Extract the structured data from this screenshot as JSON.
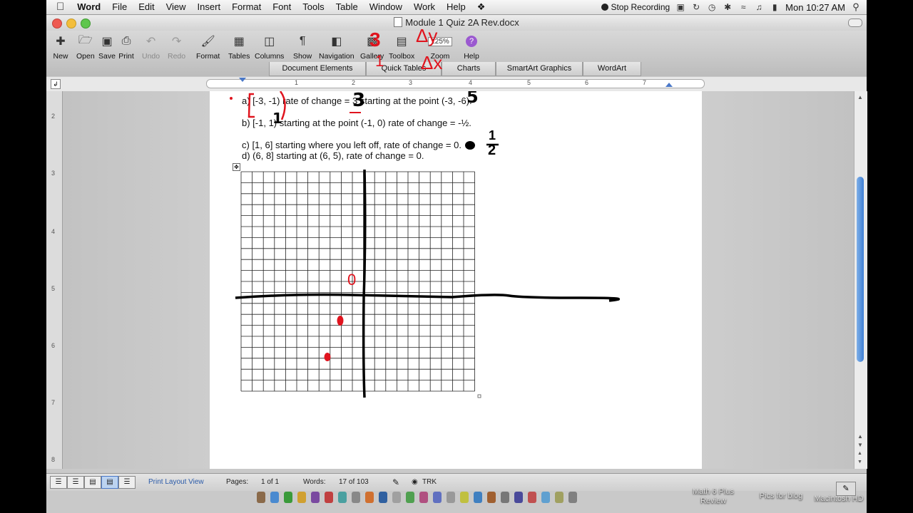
{
  "menubar": {
    "app": "Word",
    "items": [
      "File",
      "Edit",
      "View",
      "Insert",
      "Format",
      "Font",
      "Tools",
      "Table",
      "Window",
      "Work",
      "Help"
    ],
    "recording": "Stop Recording",
    "clock": "Mon 10:27 AM"
  },
  "window": {
    "title": "Module 1 Quiz 2A Rev.docx"
  },
  "toolbar": {
    "new": "New",
    "open": "Open",
    "save": "Save",
    "print": "Print",
    "undo": "Undo",
    "redo": "Redo",
    "format": "Format",
    "tables": "Tables",
    "columns": "Columns",
    "show": "Show",
    "navigation": "Navigation",
    "gallery": "Gallery",
    "toolbox": "Toolbox",
    "zoom_value": "125%",
    "zoom": "Zoom",
    "help": "Help"
  },
  "ribbon_tabs": [
    "Document Elements",
    "Quick Tables",
    "Charts",
    "SmartArt Graphics",
    "WordArt"
  ],
  "ruler": {
    "h_numbers": [
      "1",
      "2",
      "3",
      "4",
      "5",
      "6",
      "7"
    ],
    "v_numbers": [
      "2",
      "3",
      "4",
      "5",
      "6",
      "7",
      "8"
    ]
  },
  "document": {
    "line_a": "a)  [-3, -1) rate of change = 3 starting at the point (-3, -6).",
    "line_b": "b)  [-1, 1) starting at the point (-1, 0) rate of change = -½.",
    "line_c": "c)  [1, 6] starting where you left off, rate of change = 0.",
    "line_d": "d)  (6, 8] starting at (6, 5), rate of change = 0."
  },
  "annotations": {
    "three": "3",
    "five": "5",
    "one": "1",
    "two": "2",
    "zero": "0",
    "top_numerator": "3",
    "top_denominator": "1",
    "delta_y": "Δy",
    "delta_x": "Δx",
    "ink_red": "#e0141e",
    "ink_black": "#000000"
  },
  "statusbar": {
    "view": "Print Layout View",
    "pages_label": "Pages:",
    "pages_value": "1 of 1",
    "words_label": "Words:",
    "words_value": "17 of 103",
    "trk": "TRK"
  },
  "desktop": {
    "item1": "Math 6 Plus Review",
    "item2": "Pics for blog",
    "item3": "Macintosh HD"
  }
}
